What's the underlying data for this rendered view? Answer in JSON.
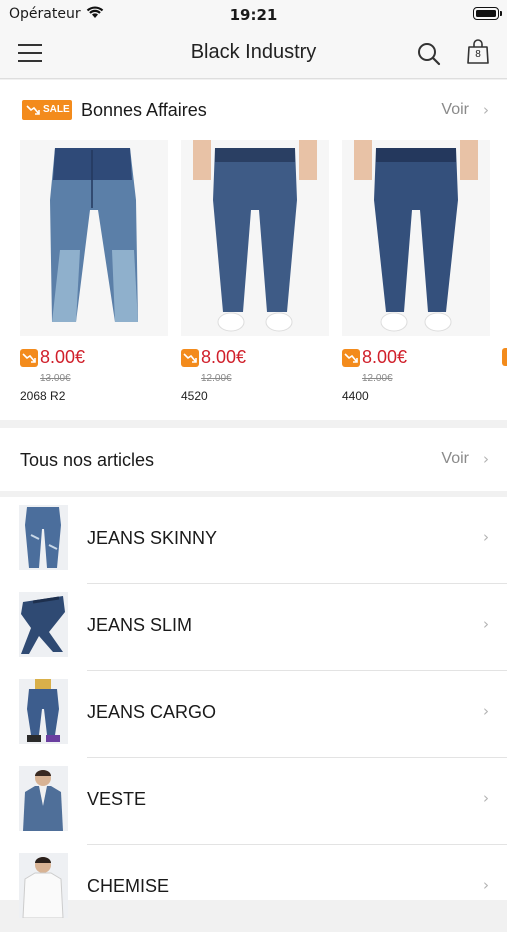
{
  "status_bar": {
    "carrier": "Opérateur",
    "time": "19:21"
  },
  "nav": {
    "title": "Black Industry",
    "cart_count": "8"
  },
  "deals": {
    "badge": "SALE",
    "title": "Bonnes Affaires",
    "see_all": "Voir",
    "products": [
      {
        "price": "8.00€",
        "old_price": "13.00€",
        "name": "2068 R2"
      },
      {
        "price": "8.00€",
        "old_price": "12.00€",
        "name": "4520"
      },
      {
        "price": "8.00€",
        "old_price": "12.00€",
        "name": "4400"
      }
    ]
  },
  "articles": {
    "title": "Tous nos articles",
    "see_all": "Voir"
  },
  "categories": [
    {
      "label": "JEANS SKINNY"
    },
    {
      "label": "JEANS SLIM"
    },
    {
      "label": "JEANS CARGO"
    },
    {
      "label": "VESTE"
    },
    {
      "label": "CHEMISE"
    }
  ],
  "colors": {
    "accent_orange": "#f38b1c",
    "price_red": "#d0202b",
    "denim": "#3d5a86"
  }
}
